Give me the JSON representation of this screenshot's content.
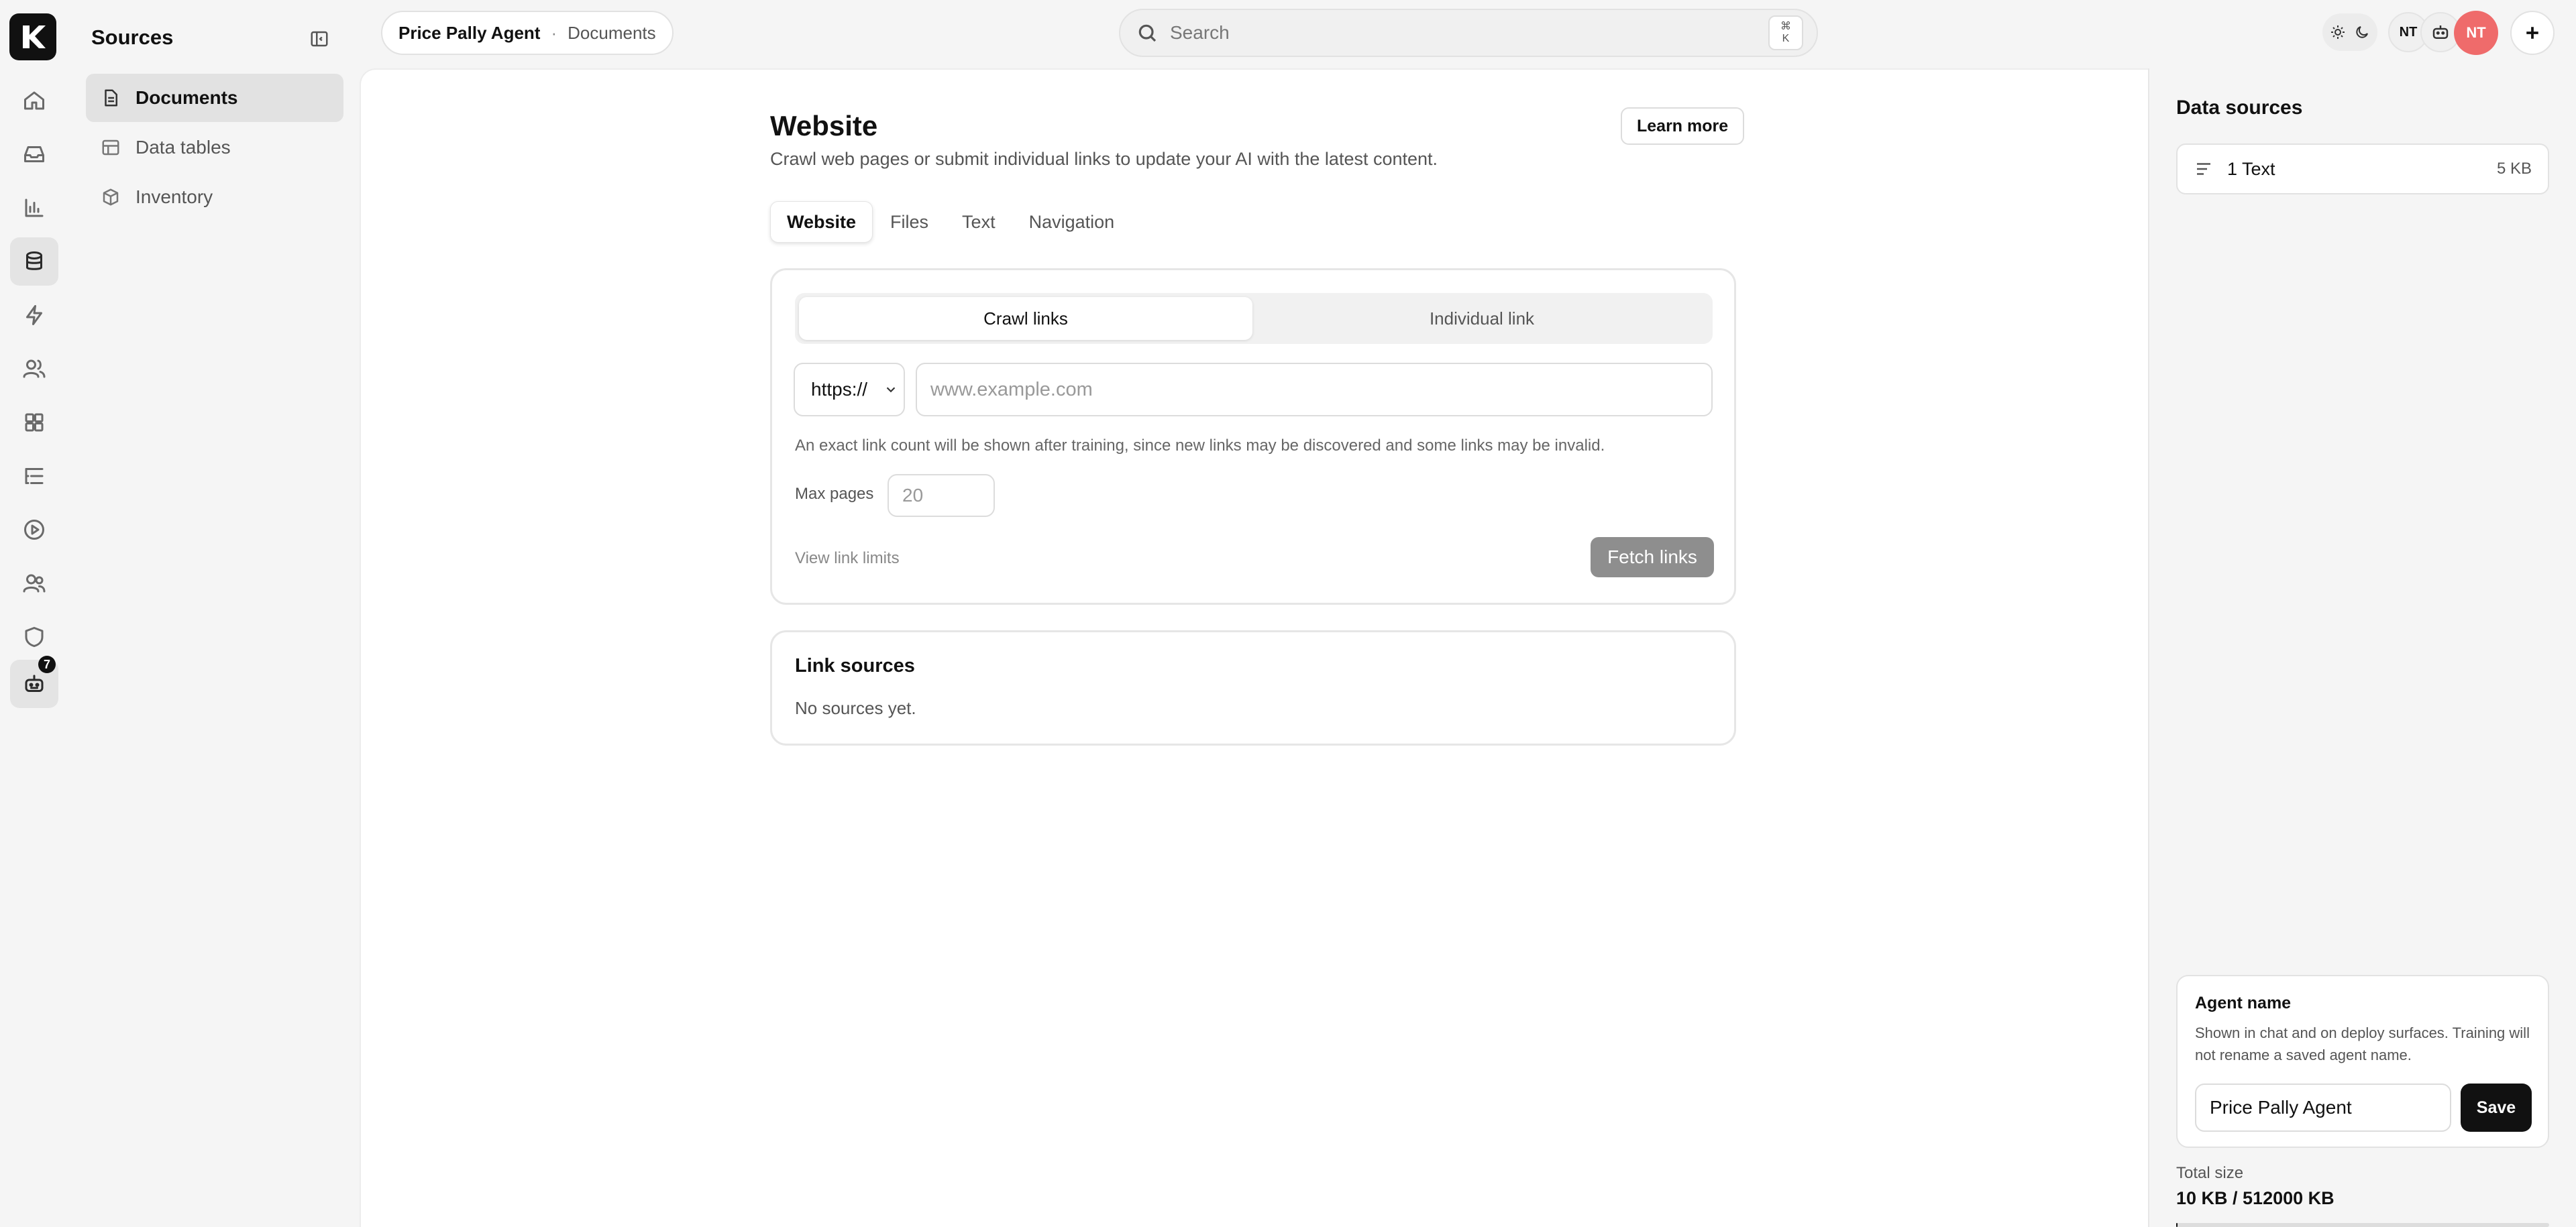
{
  "app": {
    "section_title": "Sources",
    "rail_badge": "7"
  },
  "subnav": {
    "items": [
      {
        "label": "Documents",
        "icon": "document-icon",
        "active": true
      },
      {
        "label": "Data tables",
        "icon": "table-icon",
        "active": false
      },
      {
        "label": "Inventory",
        "icon": "box-icon",
        "active": false
      }
    ]
  },
  "header": {
    "agent": "Price Pally Agent",
    "separator": "·",
    "page": "Documents",
    "search_placeholder": "Search",
    "kbd_top": "⌘",
    "kbd_bottom": "K",
    "user_initials": "NT",
    "avatar_initials": "NT"
  },
  "main": {
    "title": "Website",
    "subtitle": "Crawl web pages or submit individual links to update your AI with the latest content.",
    "learn_more": "Learn more",
    "tabs": [
      {
        "label": "Website",
        "active": true
      },
      {
        "label": "Files",
        "active": false
      },
      {
        "label": "Text",
        "active": false
      },
      {
        "label": "Navigation",
        "active": false
      }
    ],
    "crawl": {
      "mode_crawl": "Crawl links",
      "mode_individual": "Individual link",
      "protocol": "https://",
      "url_placeholder": "www.example.com",
      "hint": "An exact link count will be shown after training, since new links may be discovered and some links may be invalid.",
      "max_pages_label": "Max pages",
      "max_pages_placeholder": "20",
      "view_limits": "View link limits",
      "fetch_button": "Fetch links"
    },
    "link_sources": {
      "title": "Link sources",
      "empty": "No sources yet."
    }
  },
  "right": {
    "title": "Data sources",
    "items": [
      {
        "label": "1 Text",
        "size": "5 KB"
      }
    ],
    "agent_name": {
      "title": "Agent name",
      "description": "Shown in chat and on deploy surfaces. Training will not rename a saved agent name.",
      "value": "Price Pally Agent",
      "save": "Save"
    },
    "total_size": {
      "label": "Total size",
      "value": "10 KB / 512000 KB",
      "fraction": 2e-05
    }
  },
  "colors": {
    "accent": "#111111",
    "avatar": "#ef6b6b",
    "disabled_button": "#8e8e8e"
  }
}
